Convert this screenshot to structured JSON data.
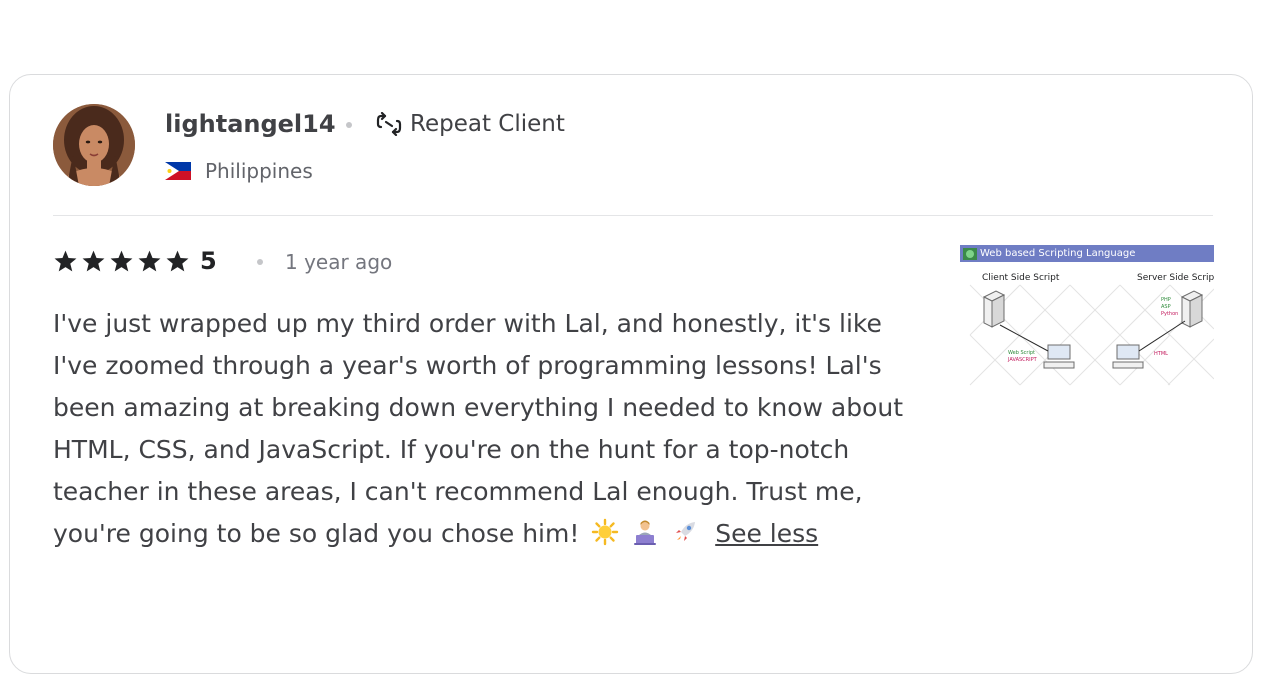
{
  "reviewer": {
    "username": "lightangel14",
    "badge": "Repeat Client",
    "country": "Philippines"
  },
  "review": {
    "rating": 5,
    "rating_label": "5",
    "time_ago": "1 year ago",
    "text": "I've just wrapped up my third order with Lal, and honestly, it's like I've zoomed through a year's worth of programming lessons! Lal's been amazing at breaking down everything I needed to know about HTML, CSS, and JavaScript. If you're on the hunt for a top-notch teacher in these areas, I can't recommend Lal enough. Trust me, you're going to be so glad you chose him!",
    "emojis": [
      "sun-emoji",
      "technologist-emoji",
      "rocket-emoji"
    ],
    "see_less_label": "See less"
  },
  "attachment": {
    "title": "Web based Scripting Language",
    "left_label": "Client Side Script",
    "right_label": "Server Side Script",
    "client_items": [
      "Web Script",
      "JAVASCRIPT"
    ],
    "server_items": [
      "PHP",
      "ASP",
      "Python"
    ],
    "html_label": "HTML"
  },
  "colors": {
    "accent_header": "#6f7dc4",
    "text_primary": "#404145",
    "text_muted": "#74767e",
    "star": "#222325"
  }
}
